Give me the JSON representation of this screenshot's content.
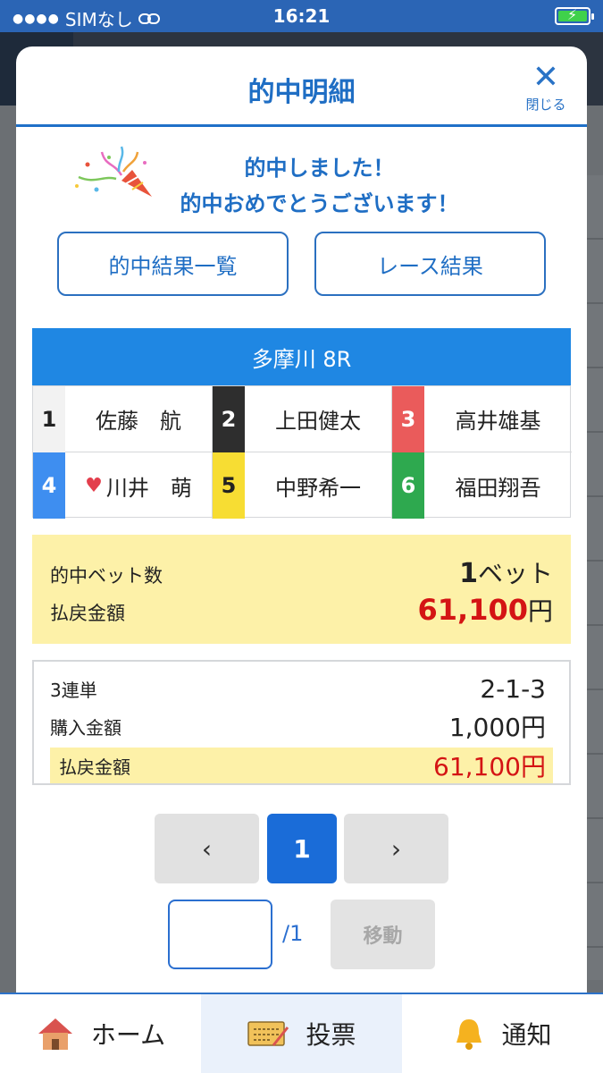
{
  "status_bar": {
    "carrier": "SIMなし",
    "time": "16:21"
  },
  "modal": {
    "title": "的中明細",
    "close_label": "閉じる",
    "congrats_line1": "的中しました！",
    "congrats_line2": "的中おめでとうございます！",
    "buttons": {
      "hit_list": "的中結果一覧",
      "race_result": "レース結果"
    },
    "race_name": "多摩川 8R",
    "racers": [
      {
        "number": "1",
        "name": "佐藤　航",
        "color": "#f2f2f2",
        "text_color": "#222222"
      },
      {
        "number": "2",
        "name": "上田健太",
        "color": "#2e2e2e",
        "text_color": "#ffffff"
      },
      {
        "number": "3",
        "name": "高井雄基",
        "color": "#ea5b5b",
        "text_color": "#ffffff"
      },
      {
        "number": "4",
        "name": "川井　萌",
        "color": "#3e8ef0",
        "text_color": "#ffffff",
        "favorite": true
      },
      {
        "number": "5",
        "name": "中野希一",
        "color": "#f7dd33",
        "text_color": "#222222"
      },
      {
        "number": "6",
        "name": "福田翔吾",
        "color": "#2ea94f",
        "text_color": "#ffffff"
      }
    ],
    "summary": {
      "bet_count_label": "的中ベット数",
      "bet_count_value": "1",
      "bet_count_unit": "ベット",
      "payout_label": "払戻金額",
      "payout_value": "61,100",
      "payout_unit": "円"
    },
    "detail": {
      "bet_type": "3連単",
      "combination": "2-1-3",
      "purchase_label": "購入金額",
      "purchase_value": "1,000円",
      "payout_label": "払戻金額",
      "payout_value": "61,100円"
    },
    "pager": {
      "prev": "‹",
      "current": "1",
      "next": "›",
      "total": "/1",
      "jump_label": "移動"
    }
  },
  "tabbar": {
    "home": "ホーム",
    "vote": "投票",
    "notify": "通知",
    "active": "vote"
  },
  "colors": {
    "accent": "#1f6ec4",
    "race_bar": "#1f87e3",
    "highlight": "#fdf1a8",
    "payout": "#d41414"
  }
}
